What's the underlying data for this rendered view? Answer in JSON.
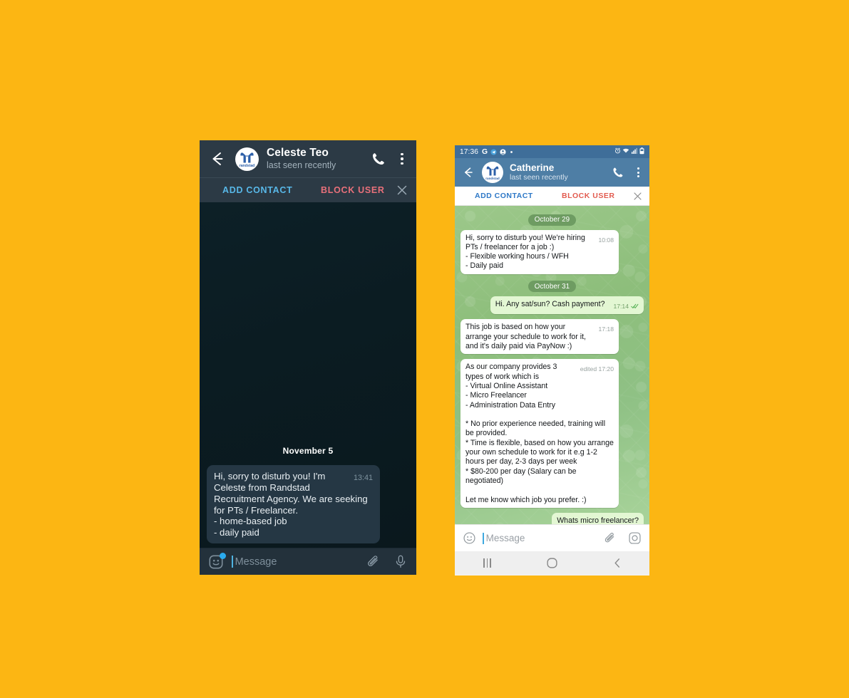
{
  "page": {
    "background_color": "#FCB613",
    "description": "Two phone screenshots of recruitment scam chats side by side"
  },
  "left_phone": {
    "app": "telegram-dark",
    "theme_colors": {
      "header": "#2C3A45",
      "body": "#0B1C22",
      "bubble_in": "#253744",
      "accent": "#58B8E8",
      "danger": "#E8707A"
    },
    "header": {
      "back_icon": "arrow-left-icon",
      "avatar_label": "randstad",
      "title": "Celeste Teo",
      "subtitle": "last seen recently",
      "call_icon": "phone-icon",
      "menu_icon": "more-vertical-icon"
    },
    "action_bar": {
      "add_contact": "ADD CONTACT",
      "block_user": "BLOCK USER",
      "close_icon": "close-icon"
    },
    "chat": {
      "date_separator": "November 5",
      "messages": [
        {
          "direction": "in",
          "text": "Hi, sorry to disturb you! I'm Celeste from Randstad Recruitment Agency. We are seeking for PTs / Freelancer.\n- home-based job\n- daily paid",
          "time": "13:41"
        }
      ]
    },
    "input_bar": {
      "emoji_icon": "emoji-smiley-icon",
      "placeholder": "Message",
      "attach_icon": "paperclip-icon",
      "mic_icon": "microphone-icon"
    }
  },
  "right_phone": {
    "app": "whatsapp-light",
    "theme_colors": {
      "status": "#3F6E99",
      "header": "#4E7EA5",
      "wallpaper": "#8FBC7E",
      "bubble_in": "#FFFFFF",
      "bubble_out": "#E3F7D3",
      "accent": "#2E78C7",
      "danger": "#E25B4F"
    },
    "status_bar": {
      "time": "17:36",
      "network": "G",
      "icons": [
        "telegram-icon",
        "contact-icon",
        "dot-icon"
      ],
      "right_icons": [
        "alarm-icon",
        "wifi-icon",
        "signal-icon",
        "battery-icon"
      ]
    },
    "header": {
      "back_icon": "arrow-left-icon",
      "avatar_label": "randstad",
      "title": "Catherine",
      "subtitle": "last seen recently",
      "call_icon": "phone-icon",
      "menu_icon": "more-vertical-icon"
    },
    "action_bar": {
      "add_contact": "ADD CONTACT",
      "block_user": "BLOCK USER",
      "close_icon": "close-icon"
    },
    "chat": {
      "items": [
        {
          "kind": "date",
          "text": "October 29"
        },
        {
          "kind": "message",
          "direction": "in",
          "text": "Hi, sorry to disturb you! We're hiring PTs / freelancer for a job :)\n- Flexible working hours / WFH\n- Daily paid",
          "time": "10:08"
        },
        {
          "kind": "date",
          "text": "October 31"
        },
        {
          "kind": "message",
          "direction": "out",
          "text": "Hi. Any sat/sun? Cash payment?",
          "time": "17:14",
          "ticks": "read"
        },
        {
          "kind": "message",
          "direction": "in",
          "text": "This job is based on how your arrange your schedule to work for it, and it's daily paid via PayNow :)",
          "time": "17:18"
        },
        {
          "kind": "message",
          "direction": "in",
          "text": "As our company provides 3 types of work which is\n- Virtual Online Assistant\n- Micro Freelancer\n- Administration Data Entry\n\n* No prior experience needed, training will be provided.\n* Time is flexible, based on how you arrange your own schedule to work for it e.g 1-2 hours per day, 2-3 days per week\n* $80-200 per day (Salary can be negotiated)\n\nLet me know which job you prefer. :)",
          "time": "edited 17:20"
        },
        {
          "kind": "message",
          "direction": "out",
          "text": "Whats micro freelancer?",
          "time": "",
          "clipped": true
        }
      ]
    },
    "input_bar": {
      "emoji_icon": "emoji-smiley-icon",
      "placeholder": "Message",
      "attach_icon": "paperclip-icon",
      "camera_icon": "camera-icon"
    },
    "nav_bar": {
      "recents_icon": "recents-icon",
      "home_icon": "home-circle-icon",
      "back_icon": "chevron-left-icon"
    }
  }
}
